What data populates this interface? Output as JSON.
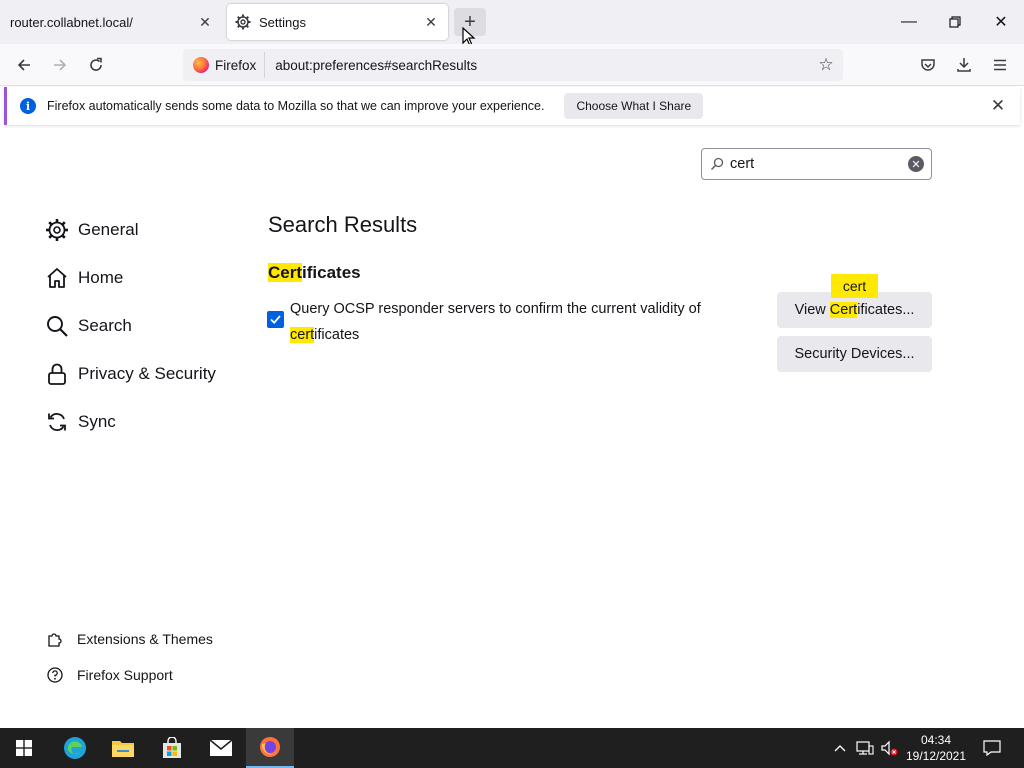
{
  "tabs": [
    {
      "title": "router.collabnet.local/"
    },
    {
      "title": "Settings"
    }
  ],
  "navbar": {
    "identity_label": "Firefox",
    "url": "about:preferences#searchResults"
  },
  "notification": {
    "message": "Firefox automatically sends some data to Mozilla so that we can improve your experience.",
    "button": "Choose What I Share"
  },
  "search": {
    "value": "cert"
  },
  "sidebar": {
    "items": [
      {
        "label": "General",
        "icon": "gear-icon"
      },
      {
        "label": "Home",
        "icon": "home-icon"
      },
      {
        "label": "Search",
        "icon": "search-icon"
      },
      {
        "label": "Privacy & Security",
        "icon": "lock-icon"
      },
      {
        "label": "Sync",
        "icon": "sync-icon"
      }
    ],
    "bottom": [
      {
        "label": "Extensions & Themes",
        "icon": "puzzle-icon"
      },
      {
        "label": "Firefox Support",
        "icon": "help-icon"
      }
    ]
  },
  "main": {
    "title": "Search Results",
    "section": {
      "match": "Cert",
      "rest": "ificates"
    },
    "checkbox": {
      "checked": true,
      "line1": "Query OCSP responder servers to confirm the current validity of",
      "line2_match": "cert",
      "line2_rest": "ificates"
    },
    "buttons": {
      "view_prefix": "View ",
      "view_match": "Cert",
      "view_rest": "ificates...",
      "security_devices": "Security Devices..."
    },
    "tooltip": "cert"
  },
  "taskbar": {
    "time": "04:34",
    "date": "19/12/2021"
  },
  "colors": {
    "accent": "#0061e0",
    "highlight": "#ffe900",
    "notification_border": "#9a56d8"
  }
}
